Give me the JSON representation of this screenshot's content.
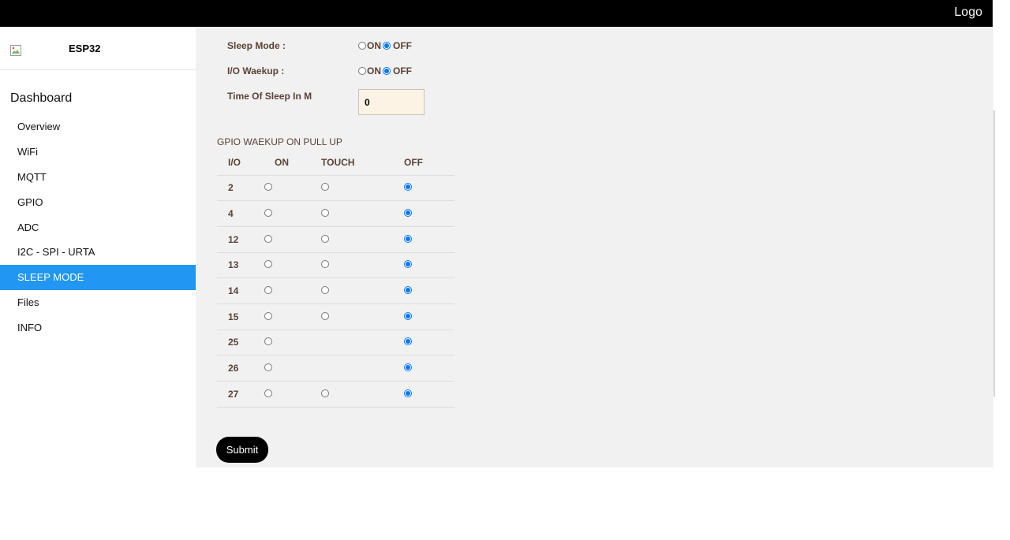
{
  "header": {
    "logo_text": "Logo"
  },
  "sidebar": {
    "brand_name": "ESP32",
    "dashboard_title": "Dashboard",
    "items": [
      {
        "label": "Overview",
        "active": false
      },
      {
        "label": "WiFi",
        "active": false
      },
      {
        "label": "MQTT",
        "active": false
      },
      {
        "label": "GPIO",
        "active": false
      },
      {
        "label": "ADC",
        "active": false
      },
      {
        "label": "I2C - SPI - URTA",
        "active": false
      },
      {
        "label": "SLEEP MODE",
        "active": true
      },
      {
        "label": "Files",
        "active": false
      },
      {
        "label": "INFO",
        "active": false
      }
    ]
  },
  "form": {
    "sleep_mode": {
      "label": "Sleep Mode :",
      "on_label": "ON",
      "off_label": "OFF",
      "selected": "OFF"
    },
    "io_wakeup": {
      "label": "I/O Waekup :",
      "on_label": "ON",
      "off_label": "OFF",
      "selected": "OFF"
    },
    "sleep_time": {
      "label": "Time Of Sleep In M",
      "value": "0"
    },
    "gpio_section_title": "GPIO WAEKUP ON PULL UP",
    "gpio_headers": {
      "io": "I/O",
      "on": "ON",
      "touch": "TOUCH",
      "off": "OFF"
    },
    "gpio_rows": [
      {
        "io": "2",
        "has_touch": true,
        "selected": "OFF"
      },
      {
        "io": "4",
        "has_touch": true,
        "selected": "OFF"
      },
      {
        "io": "12",
        "has_touch": true,
        "selected": "OFF"
      },
      {
        "io": "13",
        "has_touch": true,
        "selected": "OFF"
      },
      {
        "io": "14",
        "has_touch": true,
        "selected": "OFF"
      },
      {
        "io": "15",
        "has_touch": true,
        "selected": "OFF"
      },
      {
        "io": "25",
        "has_touch": false,
        "selected": "OFF"
      },
      {
        "io": "26",
        "has_touch": false,
        "selected": "OFF"
      },
      {
        "io": "27",
        "has_touch": true,
        "selected": "OFF"
      }
    ],
    "submit_label": "Submit"
  },
  "colors": {
    "accent": "#2196F3",
    "header_bg": "#000000",
    "content_bg": "#f1f1f1",
    "label_text": "#5b4236",
    "input_bg": "#fdf3e4"
  }
}
